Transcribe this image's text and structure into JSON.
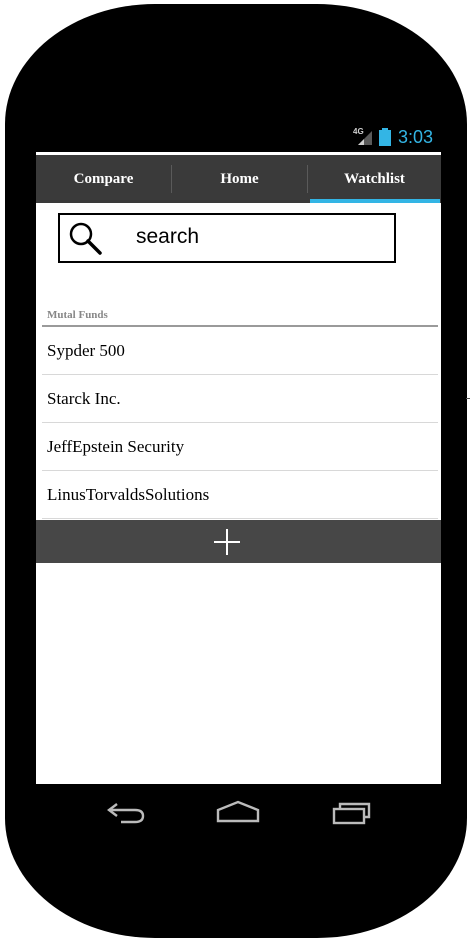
{
  "status_bar": {
    "network_label": "4G",
    "time": "3:03",
    "accent_color": "#33b5e5"
  },
  "tabs": [
    {
      "label": "Compare",
      "selected": false
    },
    {
      "label": "Home",
      "selected": false
    },
    {
      "label": "Watchlist",
      "selected": true
    }
  ],
  "search": {
    "text": "search",
    "icon": "search-icon"
  },
  "list": {
    "section_title": "Mutal Funds",
    "items": [
      {
        "label": "Sypder 500"
      },
      {
        "label": "Starck Inc."
      },
      {
        "label": "JeffEpstein Security"
      },
      {
        "label": "LinusTorvaldsSolutions"
      }
    ]
  },
  "add_bar": {
    "icon": "plus-icon"
  },
  "nav_bar": {
    "icons": [
      "back-icon",
      "home-icon",
      "recent-apps-icon"
    ]
  }
}
